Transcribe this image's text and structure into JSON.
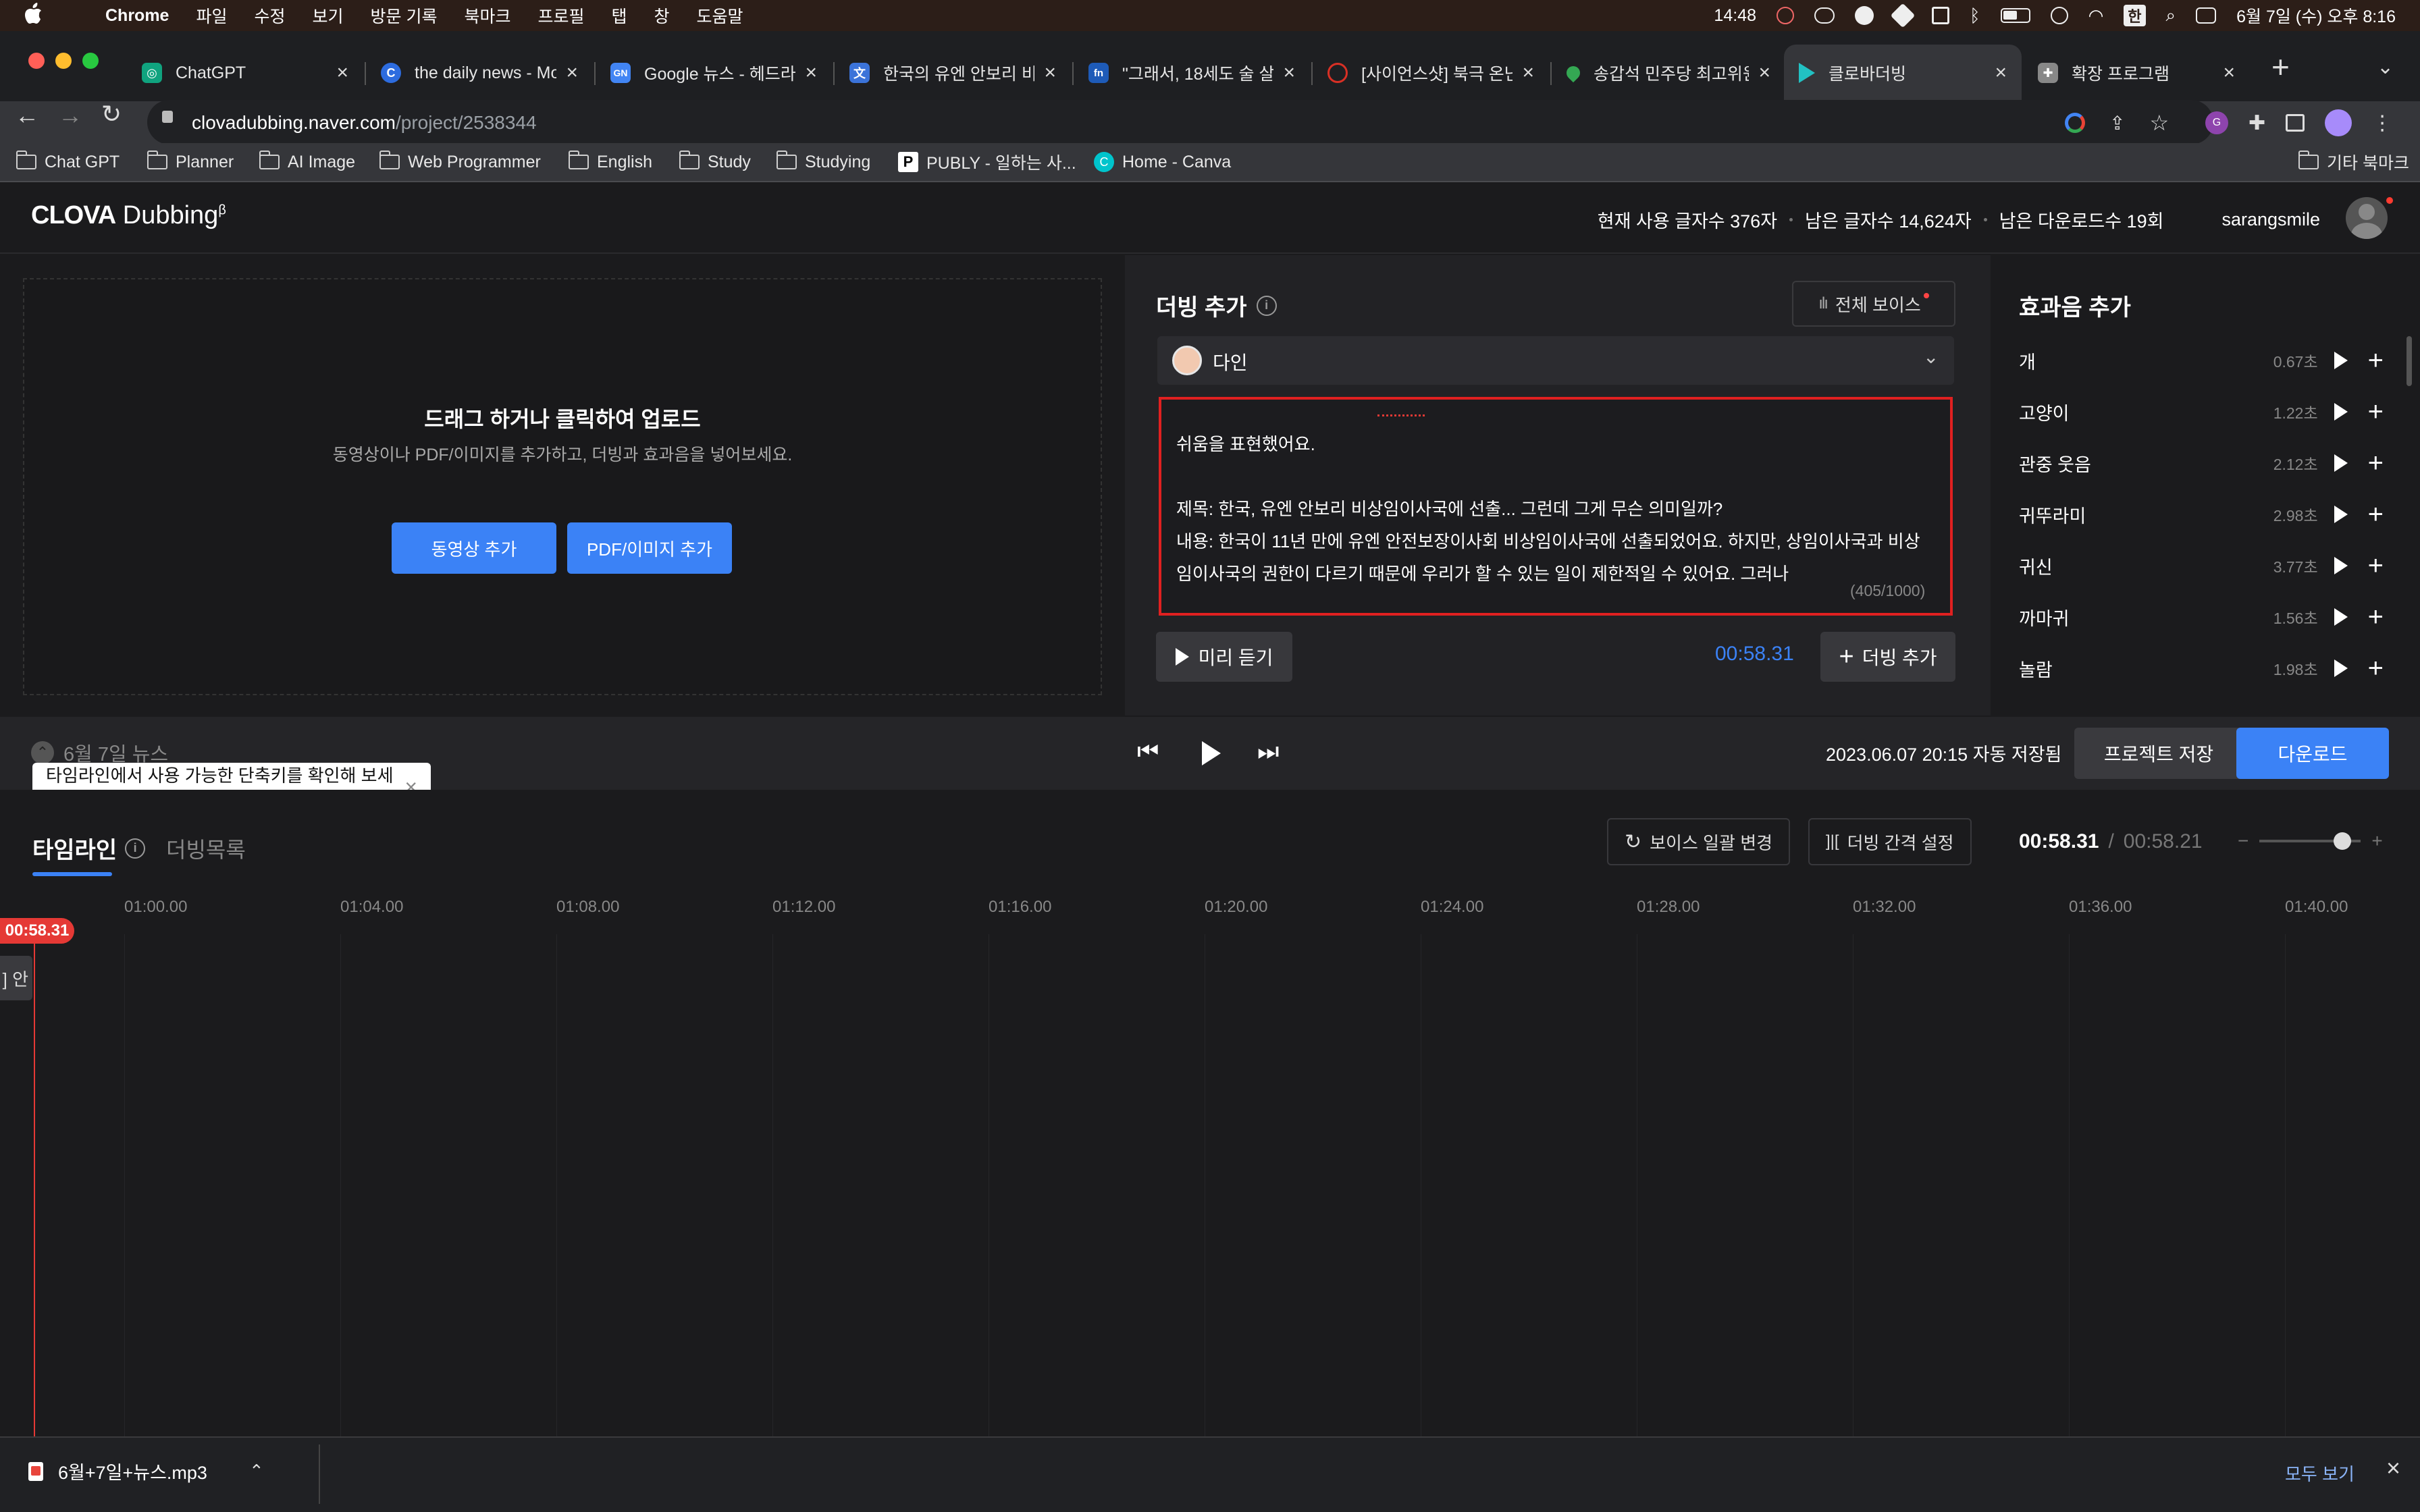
{
  "menubar": {
    "apple": "",
    "app": "Chrome",
    "menus": [
      "파일",
      "수정",
      "보기",
      "방문 기록",
      "북마크",
      "프로필",
      "탭",
      "창",
      "도움말"
    ],
    "time": "14:48",
    "ime": "한",
    "datetime": "6월 7일 (수) 오후 8:16"
  },
  "tabs": [
    {
      "title": "ChatGPT",
      "fav_color": "#10a37f"
    },
    {
      "title": "the daily news - Mo",
      "fav_color": "#2d6cdf"
    },
    {
      "title": "Google 뉴스 - 헤드라",
      "fav_color": "#4285f4"
    },
    {
      "title": "한국의 유엔 안보리 비상",
      "fav_color": "#3b73d9"
    },
    {
      "title": "\"그래서, 18세도 술 살",
      "fav_color": "#1e5bb8"
    },
    {
      "title": "[사이언스샷] 북극 온난",
      "fav_color": "#d93025"
    },
    {
      "title": "송갑석 민주당 최고위원",
      "fav_color": "#34a853"
    },
    {
      "title": "클로바더빙",
      "fav_color": "#22c1c3"
    },
    {
      "title": "확장 프로그램",
      "fav_color": "#888888"
    }
  ],
  "address": {
    "domain": "clovadubbing.naver.com",
    "path": "/project/2538344"
  },
  "bookmarks": [
    {
      "label": "Chat GPT"
    },
    {
      "label": "Planner"
    },
    {
      "label": "AI Image"
    },
    {
      "label": "Web Programmer"
    },
    {
      "label": "English"
    },
    {
      "label": "Study"
    },
    {
      "label": "Studying"
    },
    {
      "label": "PUBLY - 일하는 사..."
    },
    {
      "label": "Home - Canva"
    }
  ],
  "bookmarks_other": "기타 북마크",
  "header": {
    "logo_bold": "CLOVA",
    "logo_light": "Dubbing",
    "logo_beta": "β",
    "usage_used": "현재 사용 글자수 376자",
    "usage_left": "남은 글자수 14,624자",
    "downloads_left": "남은 다운로드수 19회",
    "username": "sarangsmile"
  },
  "upload": {
    "title": "드래그 하거나 클릭하여 업로드",
    "subtitle": "동영상이나 PDF/이미지를 추가하고, 더빙과 효과음을 넣어보세요.",
    "video_button": "동영상 추가",
    "pdf_button": "PDF/이미지 추가"
  },
  "dubbing": {
    "title": "더빙 추가",
    "all_voices": "전체 보이스",
    "voice_name": "다인",
    "text_lines": [
      "쉬움을 표현했어요.",
      "",
      "제목: 한국, 유엔 안보리 비상임이사국에 선출... 그런데 그게 무슨 의미일까?",
      "내용: 한국이 11년 만에 유엔 안전보장이사회 비상임이사국에 선출되었어요. 하지만, 상임이사국과 비상",
      "임이사국의 권한이 다르기 때문에 우리가 할 수 있는 일이 제한적일 수 있어요. 그러나"
    ],
    "char_count": "(405/1000)",
    "preview_button": "미리 듣기",
    "duration": "00:58.31",
    "add_button": "더빙 추가"
  },
  "sfx": {
    "title": "효과음 추가",
    "items": [
      {
        "name": "개",
        "duration": "0.67초"
      },
      {
        "name": "고양이",
        "duration": "1.22초"
      },
      {
        "name": "관중 웃음",
        "duration": "2.12초"
      },
      {
        "name": "귀뚜라미",
        "duration": "2.98초"
      },
      {
        "name": "귀신",
        "duration": "3.77초"
      },
      {
        "name": "까마귀",
        "duration": "1.56초"
      },
      {
        "name": "놀람",
        "duration": "1.98초"
      }
    ]
  },
  "transport": {
    "project_name": "6월 7일 뉴스",
    "tooltip": "타임라인에서 사용 가능한 단축키를 확인해 보세요.",
    "autosave": "2023.06.07 20:15 자동 저장됨",
    "save_button": "프로젝트 저장",
    "download_button": "다운로드"
  },
  "timeline": {
    "tab_timeline": "타임라인",
    "tab_dublist": "더빙목록",
    "bulk_voice": "보이스 일괄 변경",
    "interval": "더빙 간격 설정",
    "current": "00:58.31",
    "total": "00:58.21",
    "ticks": [
      "01:00.00",
      "01:04.00",
      "01:08.00",
      "01:12.00",
      "01:16.00",
      "01:20.00",
      "01:24.00",
      "01:28.00",
      "01:32.00",
      "01:36.00",
      "01:40.00"
    ],
    "playhead": "00:58.31",
    "clip_text": "] 안"
  },
  "shelf": {
    "file": "6월+7일+뉴스.mp3",
    "show_all": "모두 보기"
  },
  "colors": {
    "accent": "#3b82f6",
    "playhead": "#e53935",
    "highlight_border": "#e02020"
  }
}
